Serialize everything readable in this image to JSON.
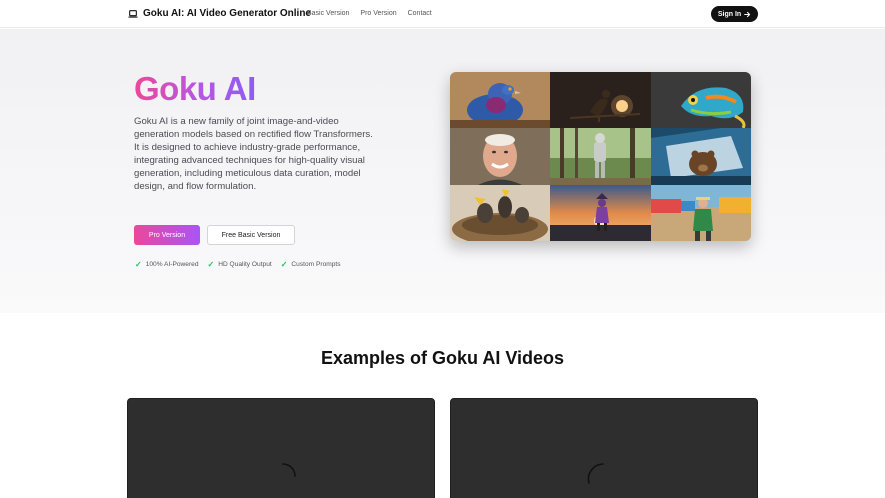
{
  "nav": {
    "brand_icon": "laptop-icon",
    "brand": "Goku AI: AI Video Generator Online",
    "links": [
      "Basic Version",
      "Pro Version",
      "Contact"
    ],
    "signin_label": "Sign In",
    "signin_icon": "arrow-right-icon"
  },
  "hero": {
    "title": "Goku AI",
    "description": "Goku AI is a new family of joint image-and-video generation models based on rectified flow Transformers. It is designed to achieve industry-grade performance, integrating advanced techniques for high-quality visual generation, including meticulous data curation, model design, and flow formulation.",
    "pro_button": "Pro Version",
    "basic_button": "Free Basic Version",
    "features": [
      "100% AI-Powered",
      "HD Quality Output",
      "Custom Prompts"
    ],
    "feature_icon": "check-icon",
    "gallery": [
      "pigeon",
      "bird-on-branch",
      "chameleon",
      "elderly-man",
      "robot-in-forest",
      "bear-in-car",
      "baby-birds-nest",
      "figure-at-sunset",
      "man-at-market"
    ]
  },
  "examples": {
    "title": "Examples of Goku AI Videos"
  },
  "colors": {
    "accent_pink": "#ec4899",
    "accent_purple": "#a855f7",
    "check_green": "#22c55e",
    "video_bg": "#2e2e2e"
  }
}
